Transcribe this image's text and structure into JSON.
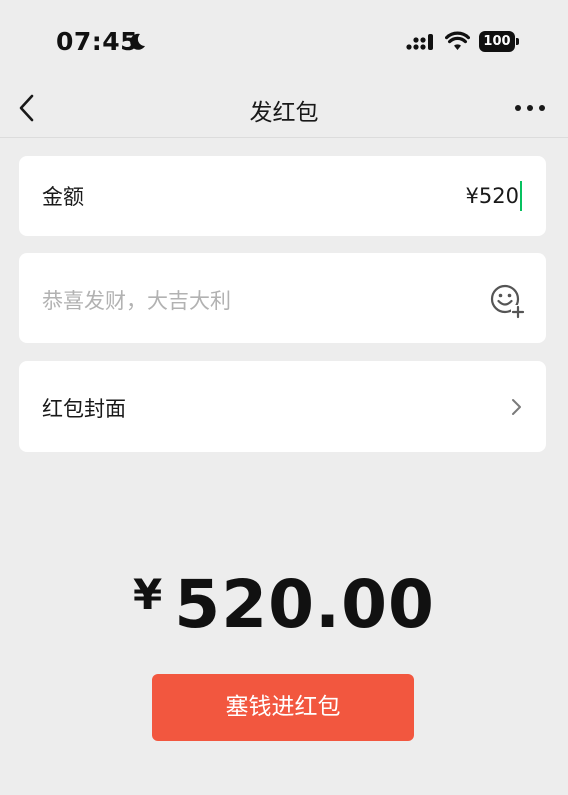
{
  "status_bar": {
    "time": "07:45",
    "battery": "100",
    "icons": [
      "moon-icon",
      "cellular-signal-icon",
      "wifi-icon",
      "battery-icon"
    ]
  },
  "nav": {
    "title": "发红包",
    "back_icon": "chevron-left-icon",
    "more_icon": "more-dots-icon"
  },
  "amount": {
    "label": "金额",
    "value": "¥520"
  },
  "message": {
    "placeholder": "恭喜发财，大吉大利",
    "emoji_icon": "emoji-plus-icon"
  },
  "cover": {
    "label": "红包封面",
    "icon": "chevron-right-icon"
  },
  "total": {
    "currency": "¥",
    "value": "520.00"
  },
  "submit": {
    "label": "塞钱进红包"
  },
  "colors": {
    "background": "#ededed",
    "card": "#ffffff",
    "accent_button": "#f2573f",
    "caret": "#07c160",
    "placeholder": "#b2b2b2"
  }
}
